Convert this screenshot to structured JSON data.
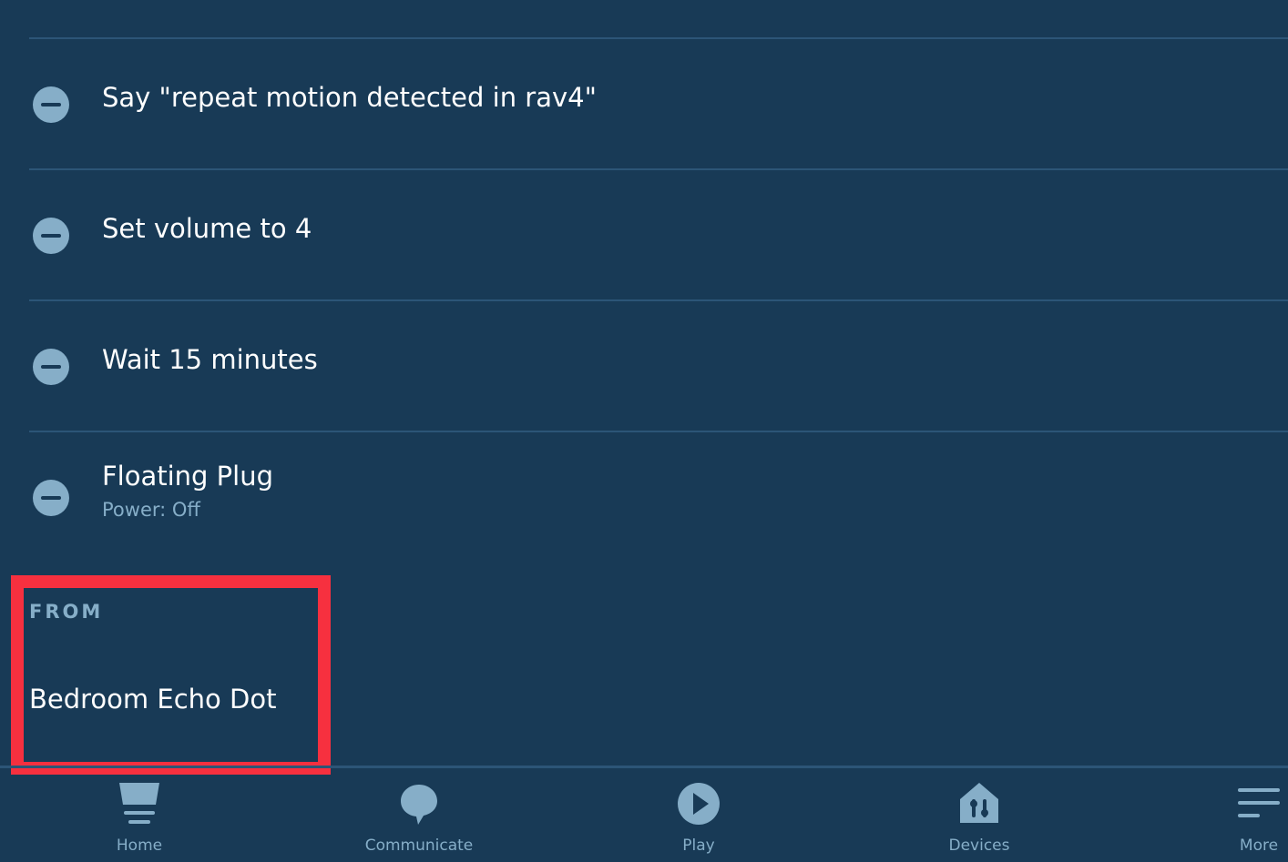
{
  "actions": [
    {
      "title": "Say \"repeat motion detected in rav4\"",
      "subtitle": ""
    },
    {
      "title": "Set volume to 4",
      "subtitle": ""
    },
    {
      "title": "Wait 15 minutes",
      "subtitle": ""
    },
    {
      "title": "Floating Plug",
      "subtitle": "Power: Off"
    }
  ],
  "from": {
    "label": "FROM",
    "device": "Bedroom Echo Dot"
  },
  "tabs": [
    {
      "label": "Home",
      "icon": "home-icon"
    },
    {
      "label": "Communicate",
      "icon": "speech-bubble-icon"
    },
    {
      "label": "Play",
      "icon": "play-icon"
    },
    {
      "label": "Devices",
      "icon": "devices-house-icon"
    },
    {
      "label": "More",
      "icon": "hamburger-menu-icon"
    }
  ],
  "colors": {
    "background": "#183a56",
    "divider": "#2c5577",
    "muted": "#86aec8",
    "highlight": "#f6303f"
  }
}
